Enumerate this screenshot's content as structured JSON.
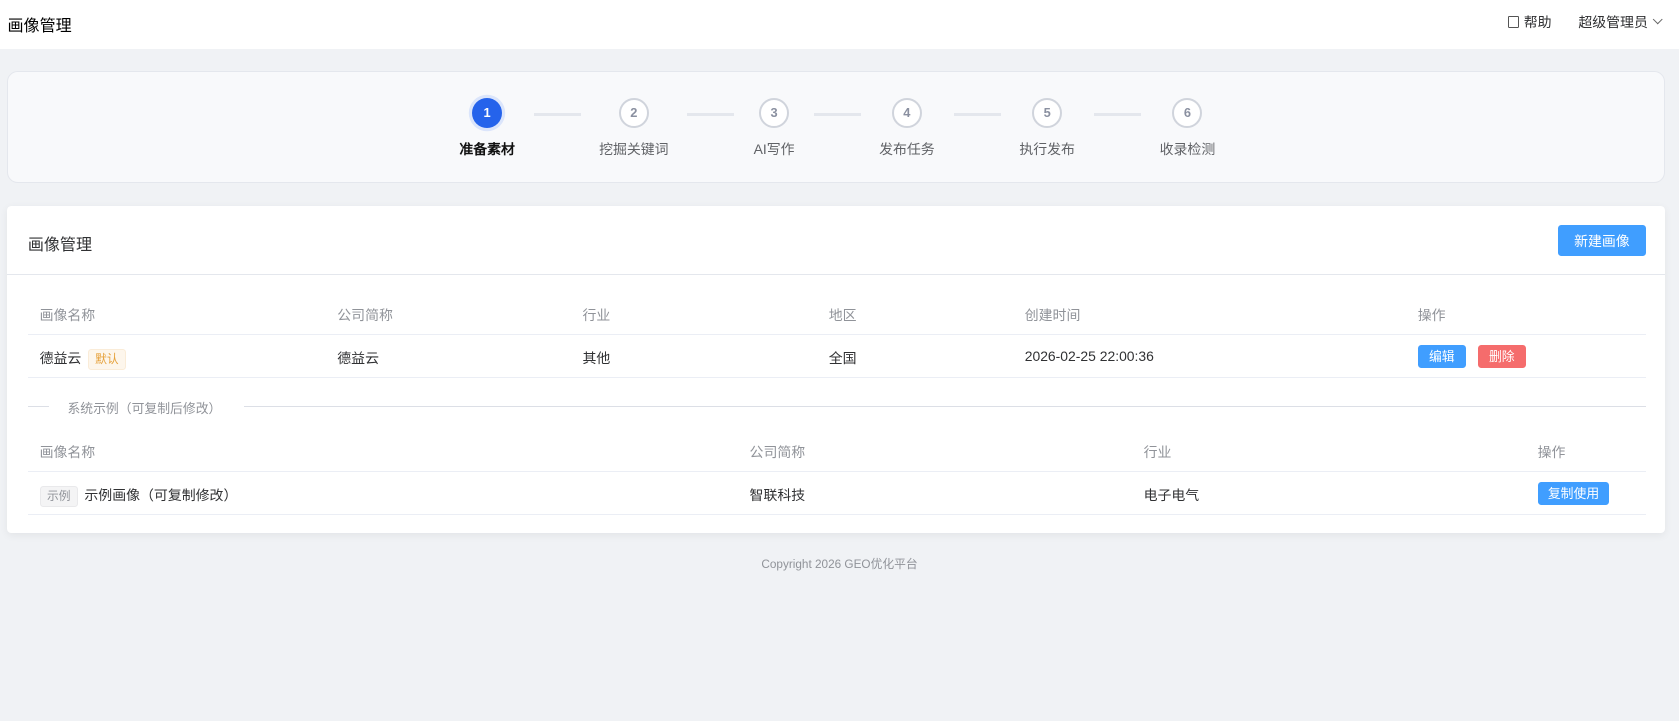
{
  "header": {
    "title": "画像管理",
    "help": "帮助",
    "user": "超级管理员"
  },
  "steps": [
    {
      "num": "1",
      "label": "准备素材",
      "active": true
    },
    {
      "num": "2",
      "label": "挖掘关键词"
    },
    {
      "num": "3",
      "label": "AI写作"
    },
    {
      "num": "4",
      "label": "发布任务"
    },
    {
      "num": "5",
      "label": "执行发布"
    },
    {
      "num": "6",
      "label": "收录检测"
    }
  ],
  "main": {
    "title": "画像管理",
    "new_button": "新建画像"
  },
  "profiles": {
    "columns": [
      "画像名称",
      "公司简称",
      "行业",
      "地区",
      "创建时间",
      "操作"
    ],
    "rows": [
      {
        "name": "德益云",
        "tag": "默认",
        "company": "德益云",
        "industry": "其他",
        "region": "全国",
        "created": "2026-02-25 22:00:36",
        "edit": "编辑",
        "delete": "删除"
      }
    ]
  },
  "samples": {
    "divider": "系统示例（可复制后修改）",
    "columns": [
      "画像名称",
      "公司简称",
      "行业",
      "操作"
    ],
    "rows": [
      {
        "tag": "示例",
        "name": "示例画像（可复制修改）",
        "company": "智联科技",
        "industry": "电子电气",
        "copy": "复制使用"
      }
    ]
  },
  "footer": "Copyright 2026 GEO优化平台",
  "colors": {
    "primary": "#409eff",
    "danger": "#f56c6c",
    "active_step": "#2563eb"
  }
}
